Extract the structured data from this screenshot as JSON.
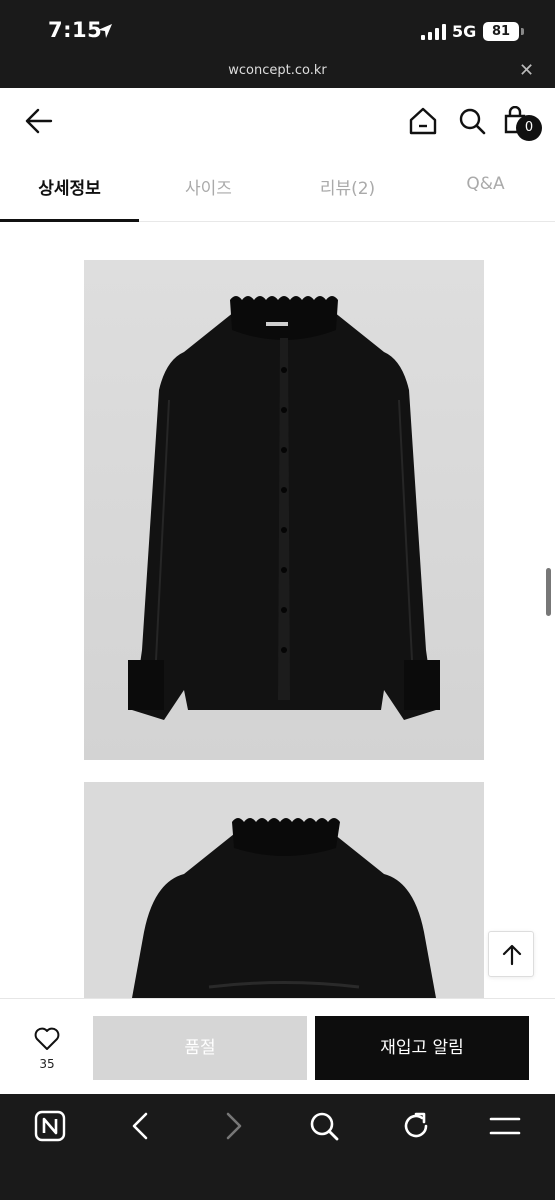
{
  "status_bar": {
    "time": "7:15",
    "network": "5G",
    "battery": "81"
  },
  "browser": {
    "url": "wconcept.co.kr"
  },
  "header": {
    "cart_count": "0"
  },
  "tabs": [
    {
      "label": "상세정보",
      "active": true
    },
    {
      "label": "사이즈",
      "active": false
    },
    {
      "label": "리뷰(2)",
      "active": false
    },
    {
      "label": "Q&A",
      "active": false
    }
  ],
  "bottom_bar": {
    "wish_count": "35",
    "soldout_label": "품절",
    "restock_label": "재입고 알림"
  },
  "colors": {
    "accent": "#111111",
    "soldout_bg": "#d6d6d6",
    "browser_chrome": "#1a1a1a"
  },
  "icons": [
    "location-arrow-icon",
    "signal-icon",
    "back-arrow-icon",
    "home-icon",
    "search-icon",
    "cart-icon",
    "heart-icon",
    "arrow-up-icon",
    "naver-n-icon",
    "chevron-left-icon",
    "chevron-right-icon",
    "refresh-icon",
    "menu-icon"
  ]
}
